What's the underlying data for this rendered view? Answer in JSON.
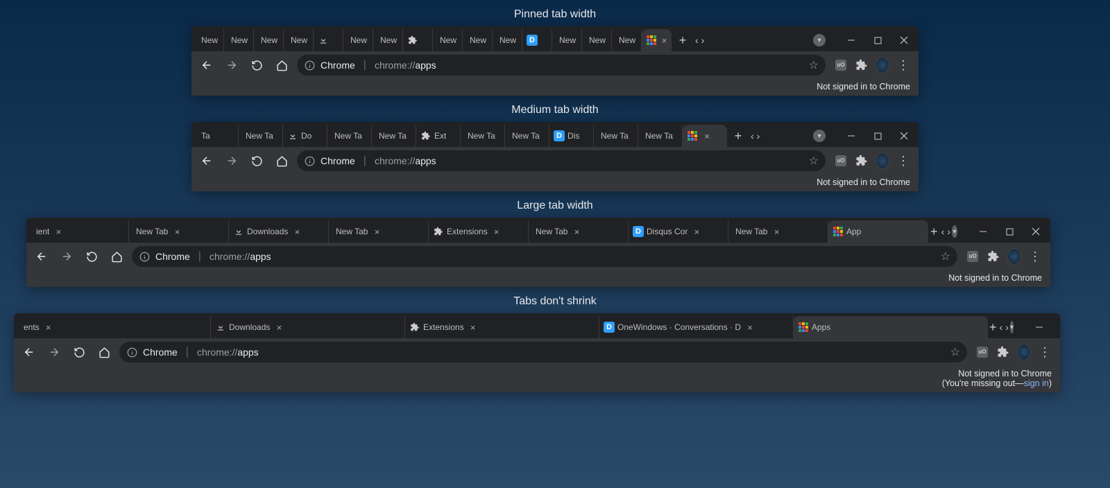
{
  "captions": {
    "pinned": "Pinned tab width",
    "medium": "Medium tab width",
    "large": "Large tab width",
    "noshrink": "Tabs don't shrink"
  },
  "omnibox": {
    "site_label": "Chrome",
    "url_prefix": "chrome://",
    "url_path": "apps"
  },
  "infobar": {
    "not_signed": "Not signed in to Chrome",
    "missing_prefix": "(You're missing out—",
    "signin": "sign in",
    "missing_suffix": ")"
  },
  "tab_labels": {
    "new": "New",
    "newt": "New T",
    "newta": "New Ta",
    "newtab": "New Tab",
    "do": "Do",
    "downloads": "Downloads",
    "ext": "Ext",
    "extensions": "Extensions",
    "dis": "Dis",
    "disqus": "Disqus Cor",
    "onewindows": "OneWindows · Conversations · D",
    "apps_short": "App",
    "apps": "Apps",
    "ents": "ents",
    "ient": "ient",
    "ta": "Ta"
  },
  "windows": [
    {
      "tabs": [
        {
          "label_key": "new",
          "icon": null
        },
        {
          "label_key": "new",
          "icon": null
        },
        {
          "label_key": "new",
          "icon": null
        },
        {
          "label_key": "new",
          "icon": null
        },
        {
          "label_key": null,
          "icon": "download"
        },
        {
          "label_key": "new",
          "icon": null
        },
        {
          "label_key": "new",
          "icon": null
        },
        {
          "label_key": null,
          "icon": "puzzle"
        },
        {
          "label_key": "new",
          "icon": null
        },
        {
          "label_key": "new",
          "icon": null
        },
        {
          "label_key": "new",
          "icon": null
        },
        {
          "label_key": null,
          "icon": "disqus"
        },
        {
          "label_key": "new",
          "icon": null
        },
        {
          "label_key": "new",
          "icon": null
        },
        {
          "label_key": "new",
          "icon": null
        },
        {
          "label_key": null,
          "icon": "apps",
          "active": true,
          "close": true
        }
      ]
    },
    {
      "tabs": [
        {
          "label_key": "ta",
          "icon": null
        },
        {
          "label_key": "newta",
          "icon": null
        },
        {
          "label_key": "do",
          "icon": "download"
        },
        {
          "label_key": "newta",
          "icon": null
        },
        {
          "label_key": "newta",
          "icon": null
        },
        {
          "label_key": "ext",
          "icon": "puzzle"
        },
        {
          "label_key": "newta",
          "icon": null
        },
        {
          "label_key": "newta",
          "icon": null
        },
        {
          "label_key": "dis",
          "icon": "disqus"
        },
        {
          "label_key": "newta",
          "icon": null
        },
        {
          "label_key": "newta",
          "icon": null
        },
        {
          "label_key": null,
          "icon": "apps",
          "active": true,
          "close": true
        }
      ]
    },
    {
      "tabs": [
        {
          "label_key": "ient",
          "icon": null,
          "close": true
        },
        {
          "label_key": "newtab",
          "icon": null,
          "close": true
        },
        {
          "label_key": "downloads",
          "icon": "download",
          "close": true
        },
        {
          "label_key": "newtab",
          "icon": null,
          "close": true
        },
        {
          "label_key": "extensions",
          "icon": "puzzle",
          "close": true
        },
        {
          "label_key": "newtab",
          "icon": null,
          "close": true
        },
        {
          "label_key": "disqus",
          "icon": "disqus",
          "close": true
        },
        {
          "label_key": "newtab",
          "icon": null,
          "close": true
        },
        {
          "label_key": "apps_short",
          "icon": "apps",
          "active": true
        }
      ]
    },
    {
      "tabs": [
        {
          "label_key": "ents",
          "icon": null,
          "close": true
        },
        {
          "label_key": "downloads",
          "icon": "download",
          "close": true
        },
        {
          "label_key": "extensions",
          "icon": "puzzle",
          "close": true
        },
        {
          "label_key": "onewindows",
          "icon": "disqus",
          "close": true
        },
        {
          "label_key": "apps",
          "icon": "apps",
          "active": true
        }
      ]
    }
  ]
}
